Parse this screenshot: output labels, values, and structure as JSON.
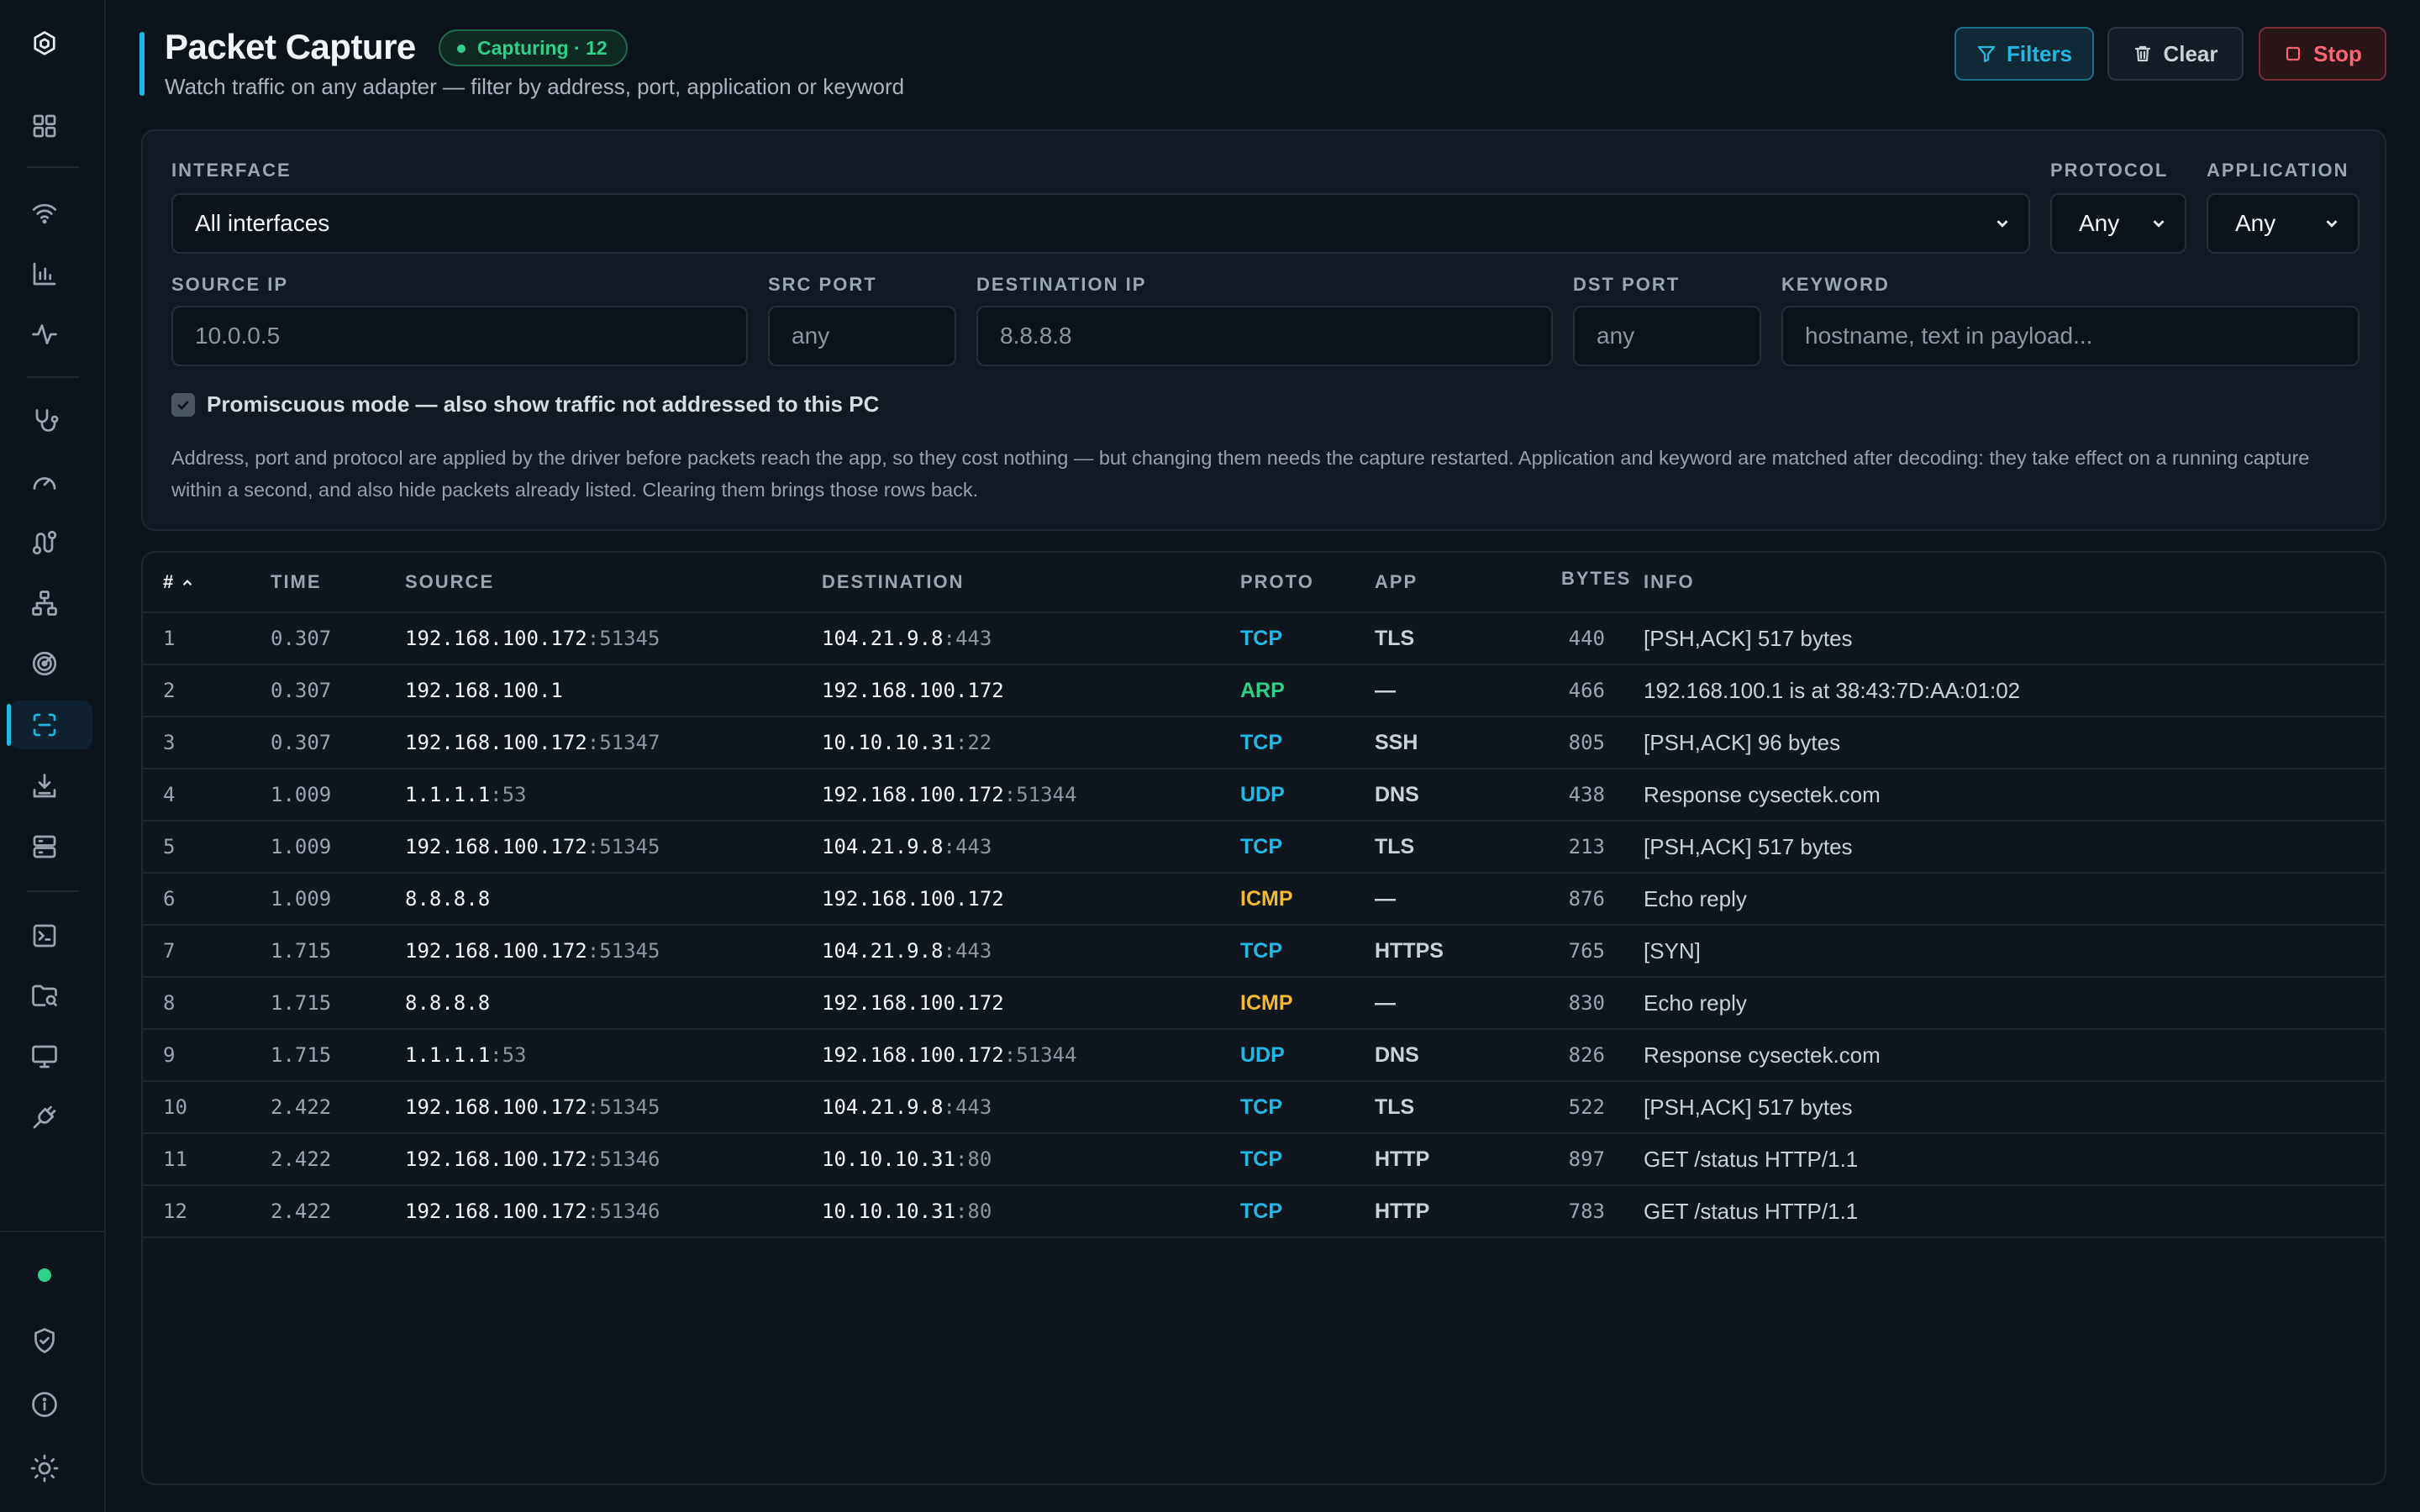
{
  "header": {
    "title": "Packet Capture",
    "badge": "Capturing · 12",
    "subtitle": "Watch traffic on any adapter — filter by address, port, application or keyword",
    "buttons": {
      "filters": "Filters",
      "clear": "Clear",
      "stop": "Stop"
    }
  },
  "filters": {
    "interface_label": "INTERFACE",
    "interface_value": "All interfaces",
    "protocol_label": "PROTOCOL",
    "protocol_value": "Any",
    "application_label": "APPLICATION",
    "application_value": "Any",
    "source_ip_label": "SOURCE IP",
    "source_ip_placeholder": "10.0.0.5",
    "src_port_label": "SRC PORT",
    "src_port_placeholder": "any",
    "destination_ip_label": "DESTINATION IP",
    "destination_ip_placeholder": "8.8.8.8",
    "dst_port_label": "DST PORT",
    "dst_port_placeholder": "any",
    "keyword_label": "KEYWORD",
    "keyword_placeholder": "hostname, text in payload...",
    "promiscuous_label": "Promiscuous mode — also show traffic not addressed to this PC",
    "promiscuous_checked": true,
    "note": "Address, port and protocol are applied by the driver before packets reach the app, so they cost nothing — but changing them needs the capture restarted. Application and keyword are matched after decoding: they take effect on a running capture within a second, and also hide packets already listed. Clearing them brings those rows back."
  },
  "table": {
    "columns": {
      "num": "#",
      "time": "TIME",
      "source": "SOURCE",
      "destination": "DESTINATION",
      "proto": "PROTO",
      "app": "APP",
      "bytes": "BYTES",
      "info": "INFO"
    },
    "rows": [
      {
        "num": "1",
        "time": "0.307",
        "src_ip": "192.168.100.172",
        "src_port": ":51345",
        "dst_ip": "104.21.9.8",
        "dst_port": ":443",
        "proto": "TCP",
        "app": "TLS",
        "bytes": "440",
        "info": "[PSH,ACK] 517 bytes"
      },
      {
        "num": "2",
        "time": "0.307",
        "src_ip": "192.168.100.1",
        "src_port": "",
        "dst_ip": "192.168.100.172",
        "dst_port": "",
        "proto": "ARP",
        "app": "—",
        "bytes": "466",
        "info": "192.168.100.1 is at 38:43:7D:AA:01:02"
      },
      {
        "num": "3",
        "time": "0.307",
        "src_ip": "192.168.100.172",
        "src_port": ":51347",
        "dst_ip": "10.10.10.31",
        "dst_port": ":22",
        "proto": "TCP",
        "app": "SSH",
        "bytes": "805",
        "info": "[PSH,ACK] 96 bytes"
      },
      {
        "num": "4",
        "time": "1.009",
        "src_ip": "1.1.1.1",
        "src_port": ":53",
        "dst_ip": "192.168.100.172",
        "dst_port": ":51344",
        "proto": "UDP",
        "app": "DNS",
        "bytes": "438",
        "info": "Response cysectek.com"
      },
      {
        "num": "5",
        "time": "1.009",
        "src_ip": "192.168.100.172",
        "src_port": ":51345",
        "dst_ip": "104.21.9.8",
        "dst_port": ":443",
        "proto": "TCP",
        "app": "TLS",
        "bytes": "213",
        "info": "[PSH,ACK] 517 bytes"
      },
      {
        "num": "6",
        "time": "1.009",
        "src_ip": "8.8.8.8",
        "src_port": "",
        "dst_ip": "192.168.100.172",
        "dst_port": "",
        "proto": "ICMP",
        "app": "—",
        "bytes": "876",
        "info": "Echo reply"
      },
      {
        "num": "7",
        "time": "1.715",
        "src_ip": "192.168.100.172",
        "src_port": ":51345",
        "dst_ip": "104.21.9.8",
        "dst_port": ":443",
        "proto": "TCP",
        "app": "HTTPS",
        "bytes": "765",
        "info": "[SYN]"
      },
      {
        "num": "8",
        "time": "1.715",
        "src_ip": "8.8.8.8",
        "src_port": "",
        "dst_ip": "192.168.100.172",
        "dst_port": "",
        "proto": "ICMP",
        "app": "—",
        "bytes": "830",
        "info": "Echo reply"
      },
      {
        "num": "9",
        "time": "1.715",
        "src_ip": "1.1.1.1",
        "src_port": ":53",
        "dst_ip": "192.168.100.172",
        "dst_port": ":51344",
        "proto": "UDP",
        "app": "DNS",
        "bytes": "826",
        "info": "Response cysectek.com"
      },
      {
        "num": "10",
        "time": "2.422",
        "src_ip": "192.168.100.172",
        "src_port": ":51345",
        "dst_ip": "104.21.9.8",
        "dst_port": ":443",
        "proto": "TCP",
        "app": "TLS",
        "bytes": "522",
        "info": "[PSH,ACK] 517 bytes"
      },
      {
        "num": "11",
        "time": "2.422",
        "src_ip": "192.168.100.172",
        "src_port": ":51346",
        "dst_ip": "10.10.10.31",
        "dst_port": ":80",
        "proto": "TCP",
        "app": "HTTP",
        "bytes": "897",
        "info": "GET /status HTTP/1.1"
      },
      {
        "num": "12",
        "time": "2.422",
        "src_ip": "192.168.100.172",
        "src_port": ":51346",
        "dst_ip": "10.10.10.31",
        "dst_port": ":80",
        "proto": "TCP",
        "app": "HTTP",
        "bytes": "783",
        "info": "GET /status HTTP/1.1"
      }
    ]
  },
  "colors": {
    "accent": "#22b8e6",
    "success": "#2fd087",
    "danger": "#ff6470",
    "proto_TCP": "#22b8e6",
    "proto_UDP": "#22b8e6",
    "proto_ARP": "#2fd087",
    "proto_ICMP": "#f5b82e"
  },
  "sidebar": {
    "icons": [
      "logo-icon",
      "dashboard-icon",
      "wifi-icon",
      "bar-chart-icon",
      "activity-icon",
      "stethoscope-icon",
      "speedometer-icon",
      "route-icon",
      "network-icon",
      "radar-icon",
      "packet-capture-icon",
      "download-icon",
      "server-icon",
      "terminal-icon",
      "folder-search-icon",
      "monitor-icon",
      "plug-icon",
      "status-dot",
      "shield-icon",
      "info-icon",
      "sun-icon"
    ]
  }
}
